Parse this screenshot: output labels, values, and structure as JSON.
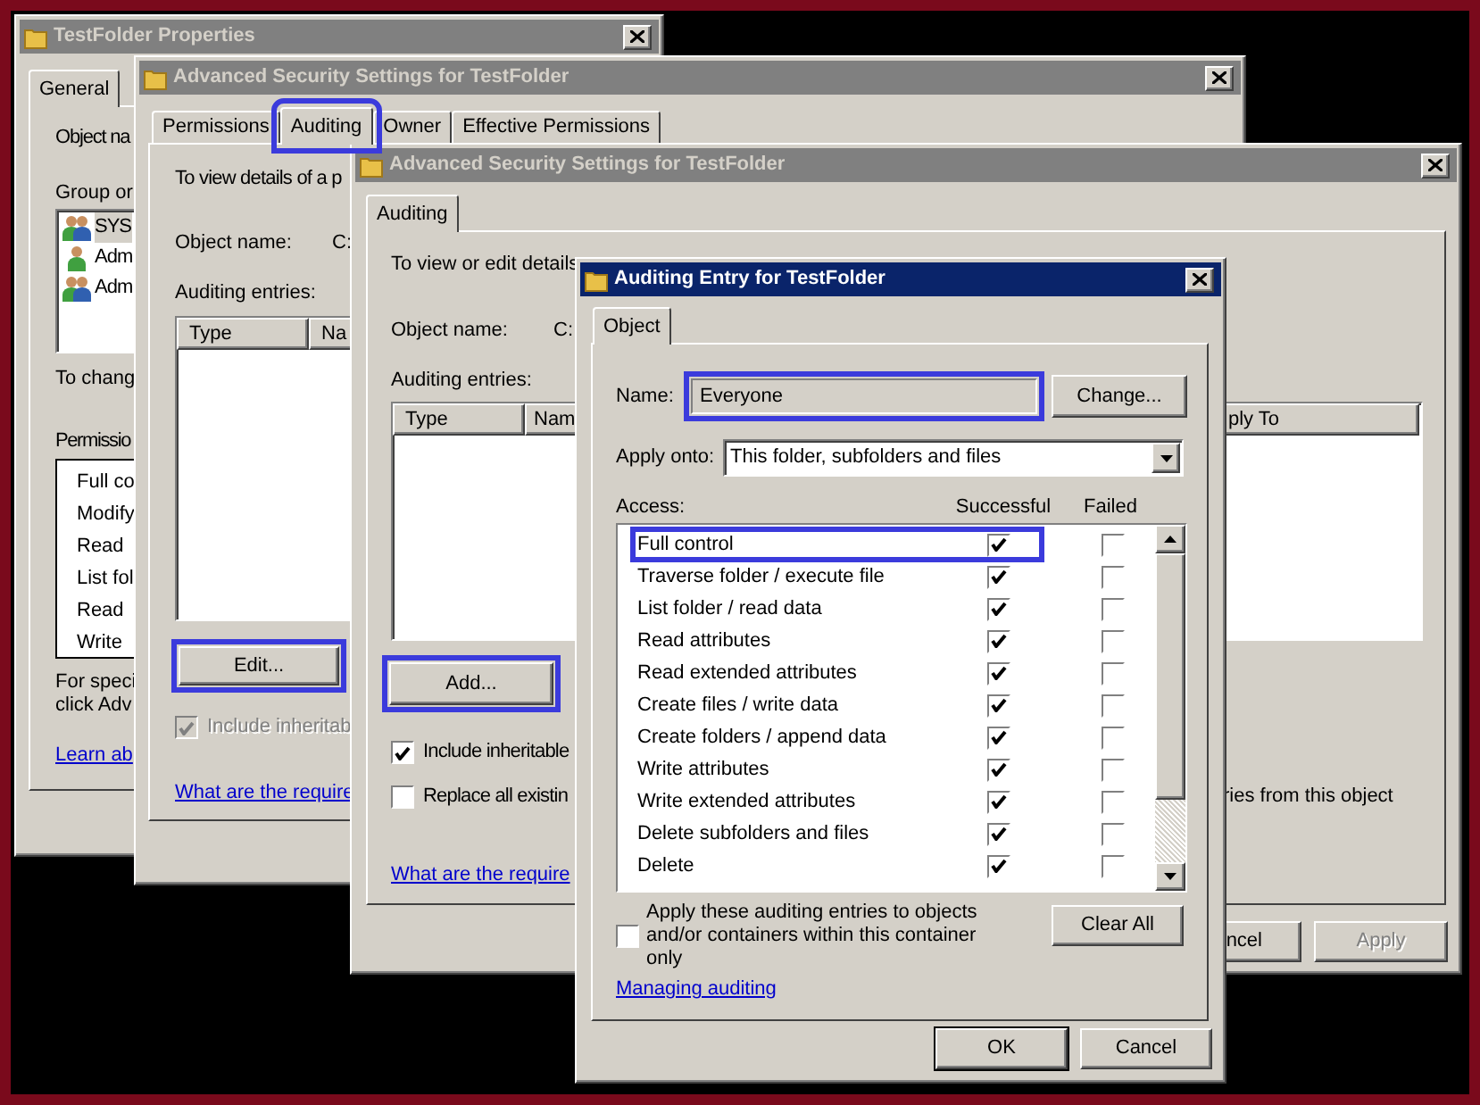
{
  "properties_window": {
    "title": "TestFolder Properties",
    "active": false,
    "tabs": [
      {
        "label": "General",
        "selected": true
      }
    ],
    "object_label": "Object na",
    "group_label": "Group or",
    "users": [
      {
        "name": "SYS",
        "kind": "group",
        "selected": true
      },
      {
        "name": "Adm",
        "kind": "user",
        "selected": false
      },
      {
        "name": "Adm",
        "kind": "group",
        "selected": false
      }
    ],
    "change_note": "To chang",
    "permissions_label": "Permissio",
    "permissions": [
      "Full co",
      "Modify",
      "Read",
      "List fol",
      "Read",
      "Write"
    ],
    "special_note": [
      "For speci",
      "click Adv"
    ],
    "learn_link": "Learn ab"
  },
  "advanced_window": {
    "title": "Advanced Security Settings for TestFolder",
    "active": false,
    "tabs": [
      {
        "label": "Permissions",
        "selected": false,
        "highlighted": false
      },
      {
        "label": "Auditing",
        "selected": true,
        "highlighted": true
      },
      {
        "label": "Owner",
        "selected": false,
        "highlighted": false
      },
      {
        "label": "Effective Permissions",
        "selected": false,
        "highlighted": false
      }
    ],
    "intro": "To view details of a p",
    "object_label": "Object name:",
    "object_value": "C:",
    "entries_label": "Auditing entries:",
    "columns": [
      "Type",
      "Na"
    ],
    "edit_button": {
      "label": "Edit...",
      "highlighted": true
    },
    "include_checkbox": {
      "label": "Include inheritab",
      "checked": true,
      "disabled": true
    },
    "help_link": "What are the require"
  },
  "edit_window": {
    "title": "Advanced Security Settings for TestFolder",
    "active": false,
    "tabs": [
      {
        "label": "Auditing",
        "selected": true
      }
    ],
    "intro": "To view or edit details",
    "object_label": "Object name:",
    "object_value": "C:",
    "entries_label": "Auditing entries:",
    "columns": [
      "Type",
      "Nam",
      "ply To"
    ],
    "add_button": {
      "label": "Add...",
      "highlighted": true
    },
    "include_checkbox": {
      "label": "Include inheritable",
      "checked": true,
      "disabled": false
    },
    "replace_checkbox": {
      "label": "Replace all existin",
      "checked": false,
      "disabled": false
    },
    "replace_tail": "ries from this object",
    "help_link": "What are the require",
    "buttons": [
      {
        "label": "ncel",
        "disabled": false
      },
      {
        "label": "Apply",
        "disabled": true
      }
    ]
  },
  "entry_dialog": {
    "title": "Auditing Entry for TestFolder",
    "active": true,
    "tabs": [
      {
        "label": "Object",
        "selected": true
      }
    ],
    "name_label": "Name:",
    "name_value": "Everyone",
    "name_highlighted": true,
    "change_button": "Change...",
    "apply_label": "Apply onto:",
    "apply_value": "This folder, subfolders and files",
    "access_label": "Access:",
    "columns": [
      "Successful",
      "Failed"
    ],
    "permissions": [
      {
        "name": "Full control",
        "successful": true,
        "failed": false,
        "highlighted": true
      },
      {
        "name": "Traverse folder / execute file",
        "successful": true,
        "failed": false,
        "highlighted": false
      },
      {
        "name": "List folder / read data",
        "successful": true,
        "failed": false,
        "highlighted": false
      },
      {
        "name": "Read attributes",
        "successful": true,
        "failed": false,
        "highlighted": false
      },
      {
        "name": "Read extended attributes",
        "successful": true,
        "failed": false,
        "highlighted": false
      },
      {
        "name": "Create files / write data",
        "successful": true,
        "failed": false,
        "highlighted": false
      },
      {
        "name": "Create folders / append data",
        "successful": true,
        "failed": false,
        "highlighted": false
      },
      {
        "name": "Write attributes",
        "successful": true,
        "failed": false,
        "highlighted": false
      },
      {
        "name": "Write extended attributes",
        "successful": true,
        "failed": false,
        "highlighted": false
      },
      {
        "name": "Delete subfolders and files",
        "successful": true,
        "failed": false,
        "highlighted": false
      },
      {
        "name": "Delete",
        "successful": true,
        "failed": false,
        "highlighted": false
      }
    ],
    "apply_children_checkbox": {
      "label": "Apply these auditing entries to objects and/or containers within this container only",
      "checked": false
    },
    "clear_button": "Clear All",
    "help_link": "Managing auditing",
    "buttons": [
      {
        "label": "OK"
      },
      {
        "label": "Cancel"
      }
    ]
  }
}
